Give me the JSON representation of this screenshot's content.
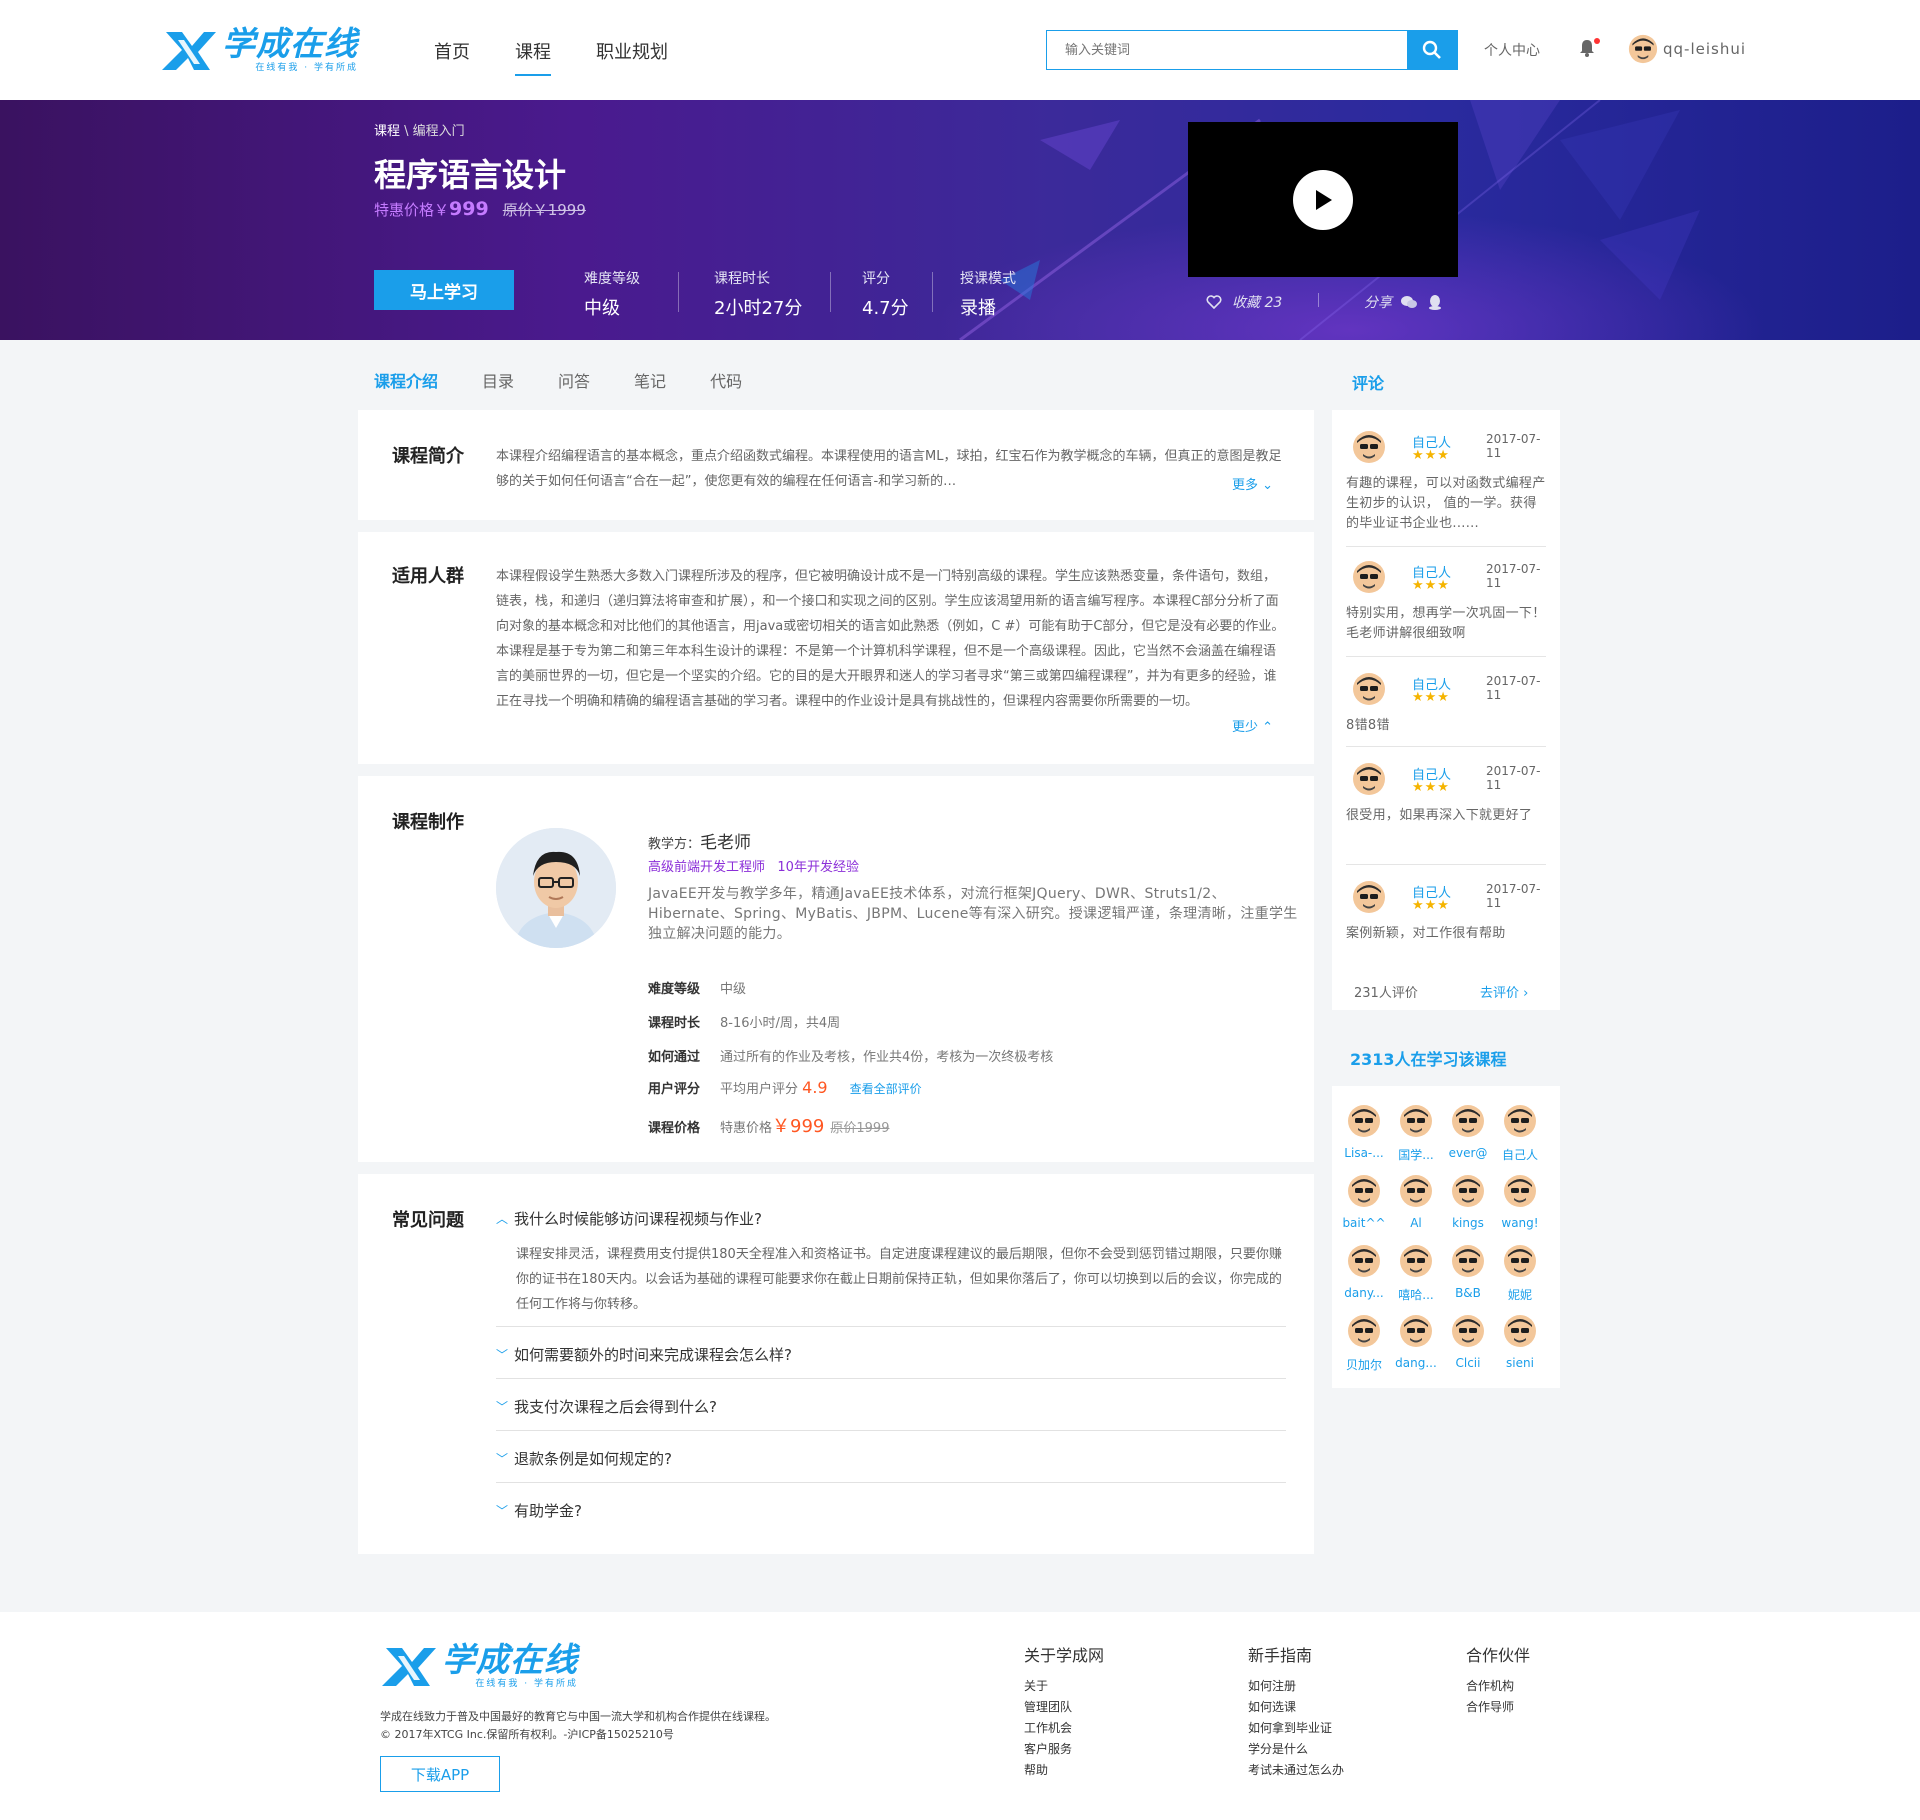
{
  "header": {
    "logo_title": "学成在线",
    "logo_sub": "在线有我 · 学有所成",
    "nav": [
      "首页",
      "课程",
      "职业规划"
    ],
    "search_placeholder": "输入关键词",
    "personal_center": "个人中心",
    "username": "qq-leishui"
  },
  "banner": {
    "breadcrumb_root": "课程",
    "breadcrumb_sep": " \\ ",
    "breadcrumb_leaf": "编程入门",
    "title": "程序语言设计",
    "price_label": "特惠价格￥",
    "price": "999",
    "original_price": "原价￥1999",
    "study_button": "马上学习",
    "stats": [
      {
        "label": "难度等级",
        "value": "中级"
      },
      {
        "label": "课程时长",
        "value": "2小时27分"
      },
      {
        "label": "评分",
        "value": "4.7分"
      },
      {
        "label": "授课模式",
        "value": "录播"
      }
    ],
    "favorite": "收藏 23",
    "share": "分享"
  },
  "tabs": [
    "课程介绍",
    "目录",
    "问答",
    "笔记",
    "代码"
  ],
  "intro": {
    "title": "课程简介",
    "text": "本课程介绍编程语言的基本概念，重点介绍函数式编程。本课程使用的语言ML，球拍，红宝石作为教学概念的车辆，但真正的意图是教足够的关于如何任何语言“合在一起”，使您更有效的编程在任何语言-和学习新的…",
    "more": "更多"
  },
  "audience": {
    "title": "适用人群",
    "text": "本课程假设学生熟悉大多数入门课程所涉及的程序，但它被明确设计成不是一门特别高级的课程。学生应该熟悉变量，条件语句，数组，链表，栈，和递归（递归算法将审查和扩展），和一个接口和实现之间的区别。学生应该渴望用新的语言编写程序。本课程C部分分析了面向对象的基本概念和对比他们的其他语言，用java或密切相关的语言如此熟悉（例如，C #）可能有助于C部分，但它是没有必要的作业。本课程是基于专为第二和第三年本科生设计的课程：不是第一个计算机科学课程，但不是一个高级课程。因此，它当然不会涵盖在编程语言的美丽世界的一切，但它是一个坚实的介绍。它的目的是大开眼界和迷人的学习者寻求“第三或第四编程课程”，并为有更多的经验，谁正在寻找一个明确和精确的编程语言基础的学习者。课程中的作业设计是具有挑战性的，但课程内容需要你所需要的一切。",
    "less": "更少"
  },
  "production": {
    "title": "课程制作",
    "teacher_label": "教学方：",
    "teacher_name": "毛老师",
    "teacher_tags": "高级前端开发工程师   10年开发经验",
    "teacher_desc": "JavaEE开发与教学多年，精通JavaEE技术体系，对流行框架JQuery、DWR、Struts1/2、Hibernate、Spring、MyBatis、JBPM、Lucene等有深入研究。授课逻辑严谨，条理清晰，注重学生独立解决问题的能力。",
    "rows": {
      "level_k": "难度等级",
      "level_v": "中级",
      "time_k": "课程时长",
      "time_v": "8-16小时/周，共4周",
      "pass_k": "如何通过",
      "pass_v": "通过所有的作业及考核，作业共4份，考核为一次终极考核",
      "score_k": "用户评分",
      "score_pre": "平均用户评分",
      "score_v": "4.9",
      "score_link": "查看全部评价",
      "price_k": "课程价格",
      "price_pre": "特惠价格",
      "price_v": "￥999",
      "price_old": "原价1999"
    }
  },
  "faq": {
    "title": "常见问题",
    "items": [
      {
        "q": "我什么时候能够访问课程视频与作业?",
        "a": "课程安排灵活，课程费用支付提供180天全程准入和资格证书。自定进度课程建议的最后期限，但你不会受到惩罚错过期限，只要你赚你的证书在180天内。以会话为基础的课程可能要求你在截止日期前保持正轨，但如果你落后了，你可以切换到以后的会议，你完成的任何工作将与你转移。"
      },
      {
        "q": "如何需要额外的时间来完成课程会怎么样?"
      },
      {
        "q": "我支付次课程之后会得到什么?"
      },
      {
        "q": "退款条例是如何规定的?"
      },
      {
        "q": "有助学金?"
      }
    ]
  },
  "comments": {
    "title": "评论",
    "items": [
      {
        "name": "自己人",
        "date": "2017-07-11",
        "stars": "★★★",
        "text": "有趣的课程，可以对函数式编程产生初步的认识， 值的一学。获得的毕业证书企业也......"
      },
      {
        "name": "自己人",
        "date": "2017-07-11",
        "stars": "★★★",
        "text": "特别实用，想再学一次巩固一下！毛老师讲解很细致啊"
      },
      {
        "name": "自己人",
        "date": "2017-07-11",
        "stars": "★★★",
        "text": "8错8错"
      },
      {
        "name": "自己人",
        "date": "2017-07-11",
        "stars": "★★★",
        "text": "很受用，如果再深入下就更好了"
      },
      {
        "name": "自己人",
        "date": "2017-07-11",
        "stars": "★★★",
        "text": "案例新颖，对工作很有帮助"
      }
    ],
    "count": "231人评价",
    "go": "去评价"
  },
  "learners": {
    "title": "2313人在学习该课程",
    "names": [
      "Lisa-...",
      "国学...",
      "ever@",
      "自己人",
      "bait^^",
      "Al",
      "kings",
      "wang!",
      "dany...",
      "嘻哈...",
      "B&B",
      "妮妮",
      "贝加尔",
      "dang...",
      "Clcii",
      "sieni"
    ]
  },
  "footer": {
    "desc1": "学成在线致力于普及中国最好的教育它与中国一流大学和机构合作提供在线课程。",
    "desc2": "© 2017年XTCG Inc.保留所有权利。-沪ICP备15025210号",
    "app": "下载APP",
    "cols": [
      {
        "title": "关于学成网",
        "links": [
          "关于",
          "管理团队",
          "工作机会",
          "客户服务",
          "帮助"
        ]
      },
      {
        "title": "新手指南",
        "links": [
          "如何注册",
          "如何选课",
          "如何拿到毕业证",
          "学分是什么",
          "考试未通过怎么办"
        ]
      },
      {
        "title": "合作伙伴",
        "links": [
          "合作机构",
          "合作导师"
        ]
      }
    ]
  },
  "colors": {
    "accent": "#1a9eea",
    "purple": "#8b2ed8",
    "star": "#f5b400"
  }
}
